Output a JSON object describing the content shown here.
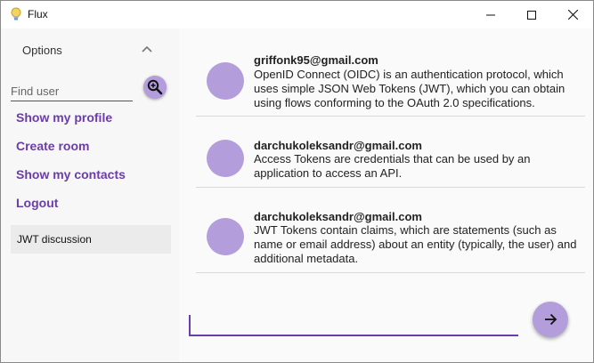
{
  "window": {
    "title": "Flux",
    "icons": {
      "app": "lightbulb-icon",
      "minimize": "minimize-icon",
      "maximize": "maximize-icon",
      "close": "close-icon"
    }
  },
  "sidebar": {
    "options_label": "Options",
    "options_icon": "chevron-up-icon",
    "search": {
      "placeholder": "Find user",
      "value": "",
      "icon": "zoom-in-icon"
    },
    "menu": [
      {
        "label": "Show my profile"
      },
      {
        "label": "Create room"
      },
      {
        "label": "Show my contacts"
      },
      {
        "label": "Logout"
      }
    ],
    "rooms": [
      {
        "label": "JWT discussion"
      }
    ]
  },
  "messages": [
    {
      "author": "griffonk95@gmail.com",
      "text": "OpenID Connect (OIDC) is an authentication protocol, which uses simple JSON Web Tokens (JWT), which you can obtain using flows conforming to the OAuth 2.0 specifications."
    },
    {
      "author": "darchukoleksandr@gmail.com",
      "text": "Access Tokens are credentials that can be used by an application to access an API."
    },
    {
      "author": "darchukoleksandr@gmail.com",
      "text": "JWT Tokens contain claims, which are statements (such as name or email address) about an entity (typically, the user) and additional metadata."
    }
  ],
  "compose": {
    "value": "",
    "placeholder": "",
    "send_icon": "arrow-right-icon"
  },
  "colors": {
    "accent": "#6a3da8",
    "avatar": "#b39ddb",
    "button": "#b39ddb"
  }
}
